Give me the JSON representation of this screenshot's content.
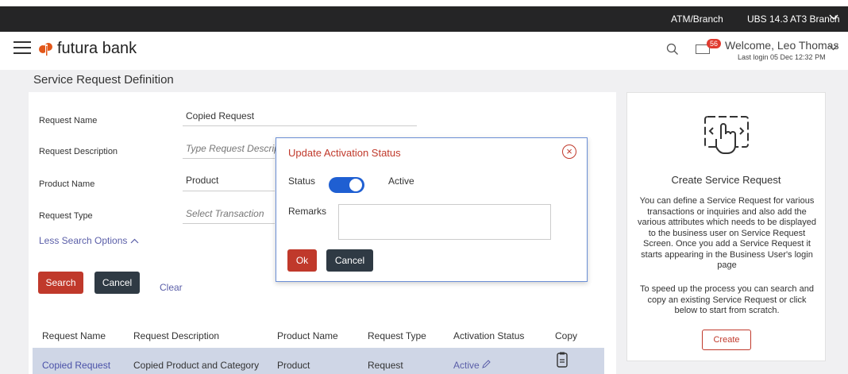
{
  "topbar": {
    "atm_label": "ATM/Branch",
    "branch_label": "UBS 14.3 AT3 Branch"
  },
  "header": {
    "bank_name": "futura bank",
    "mail_count": "56",
    "welcome": "Welcome, Leo Thomas",
    "last_login": "Last login 05 Dec 12:32 PM"
  },
  "page": {
    "title": "Service Request Definition"
  },
  "form": {
    "request_name_label": "Request Name",
    "request_name_value": "Copied Request",
    "request_description_label": "Request Description",
    "request_description_placeholder": "Type Request Descript",
    "product_name_label": "Product Name",
    "product_name_value": "Product",
    "request_type_label": "Request Type",
    "request_type_placeholder": "Select Transaction",
    "less_search_options": "Less Search Options",
    "search_button": "Search",
    "cancel_button": "Cancel",
    "clear_link": "Clear"
  },
  "table": {
    "headers": [
      "Request Name",
      "Request Description",
      "Product Name",
      "Request Type",
      "Activation Status",
      "Copy"
    ],
    "rows": [
      {
        "request_name": "Copied Request",
        "request_description": "Copied Product and Category",
        "product_name": "Product",
        "request_type": "Request",
        "activation_status": "Active"
      }
    ]
  },
  "right_panel": {
    "title": "Create Service Request",
    "description": "You can define a Service Request for various transactions or inquiries and also add the various attributes which needs to be displayed to the business user on Service Request Screen. Once you add a Service Request it starts appearing in the Business User's login page",
    "description2": "To speed up the process you can search and copy an existing Service Request or click below to start from scratch.",
    "create_button": "Create"
  },
  "modal": {
    "title": "Update Activation Status",
    "status_label": "Status",
    "status_value": "Active",
    "remarks_label": "Remarks",
    "remarks_value": "",
    "ok_button": "Ok",
    "cancel_button": "Cancel"
  },
  "colors": {
    "brand": "#e2571a",
    "primary_button": "#c0392b",
    "secondary_button": "#2f3a44",
    "toggle_on": "#1f5fd2",
    "link": "#4a51a8"
  }
}
